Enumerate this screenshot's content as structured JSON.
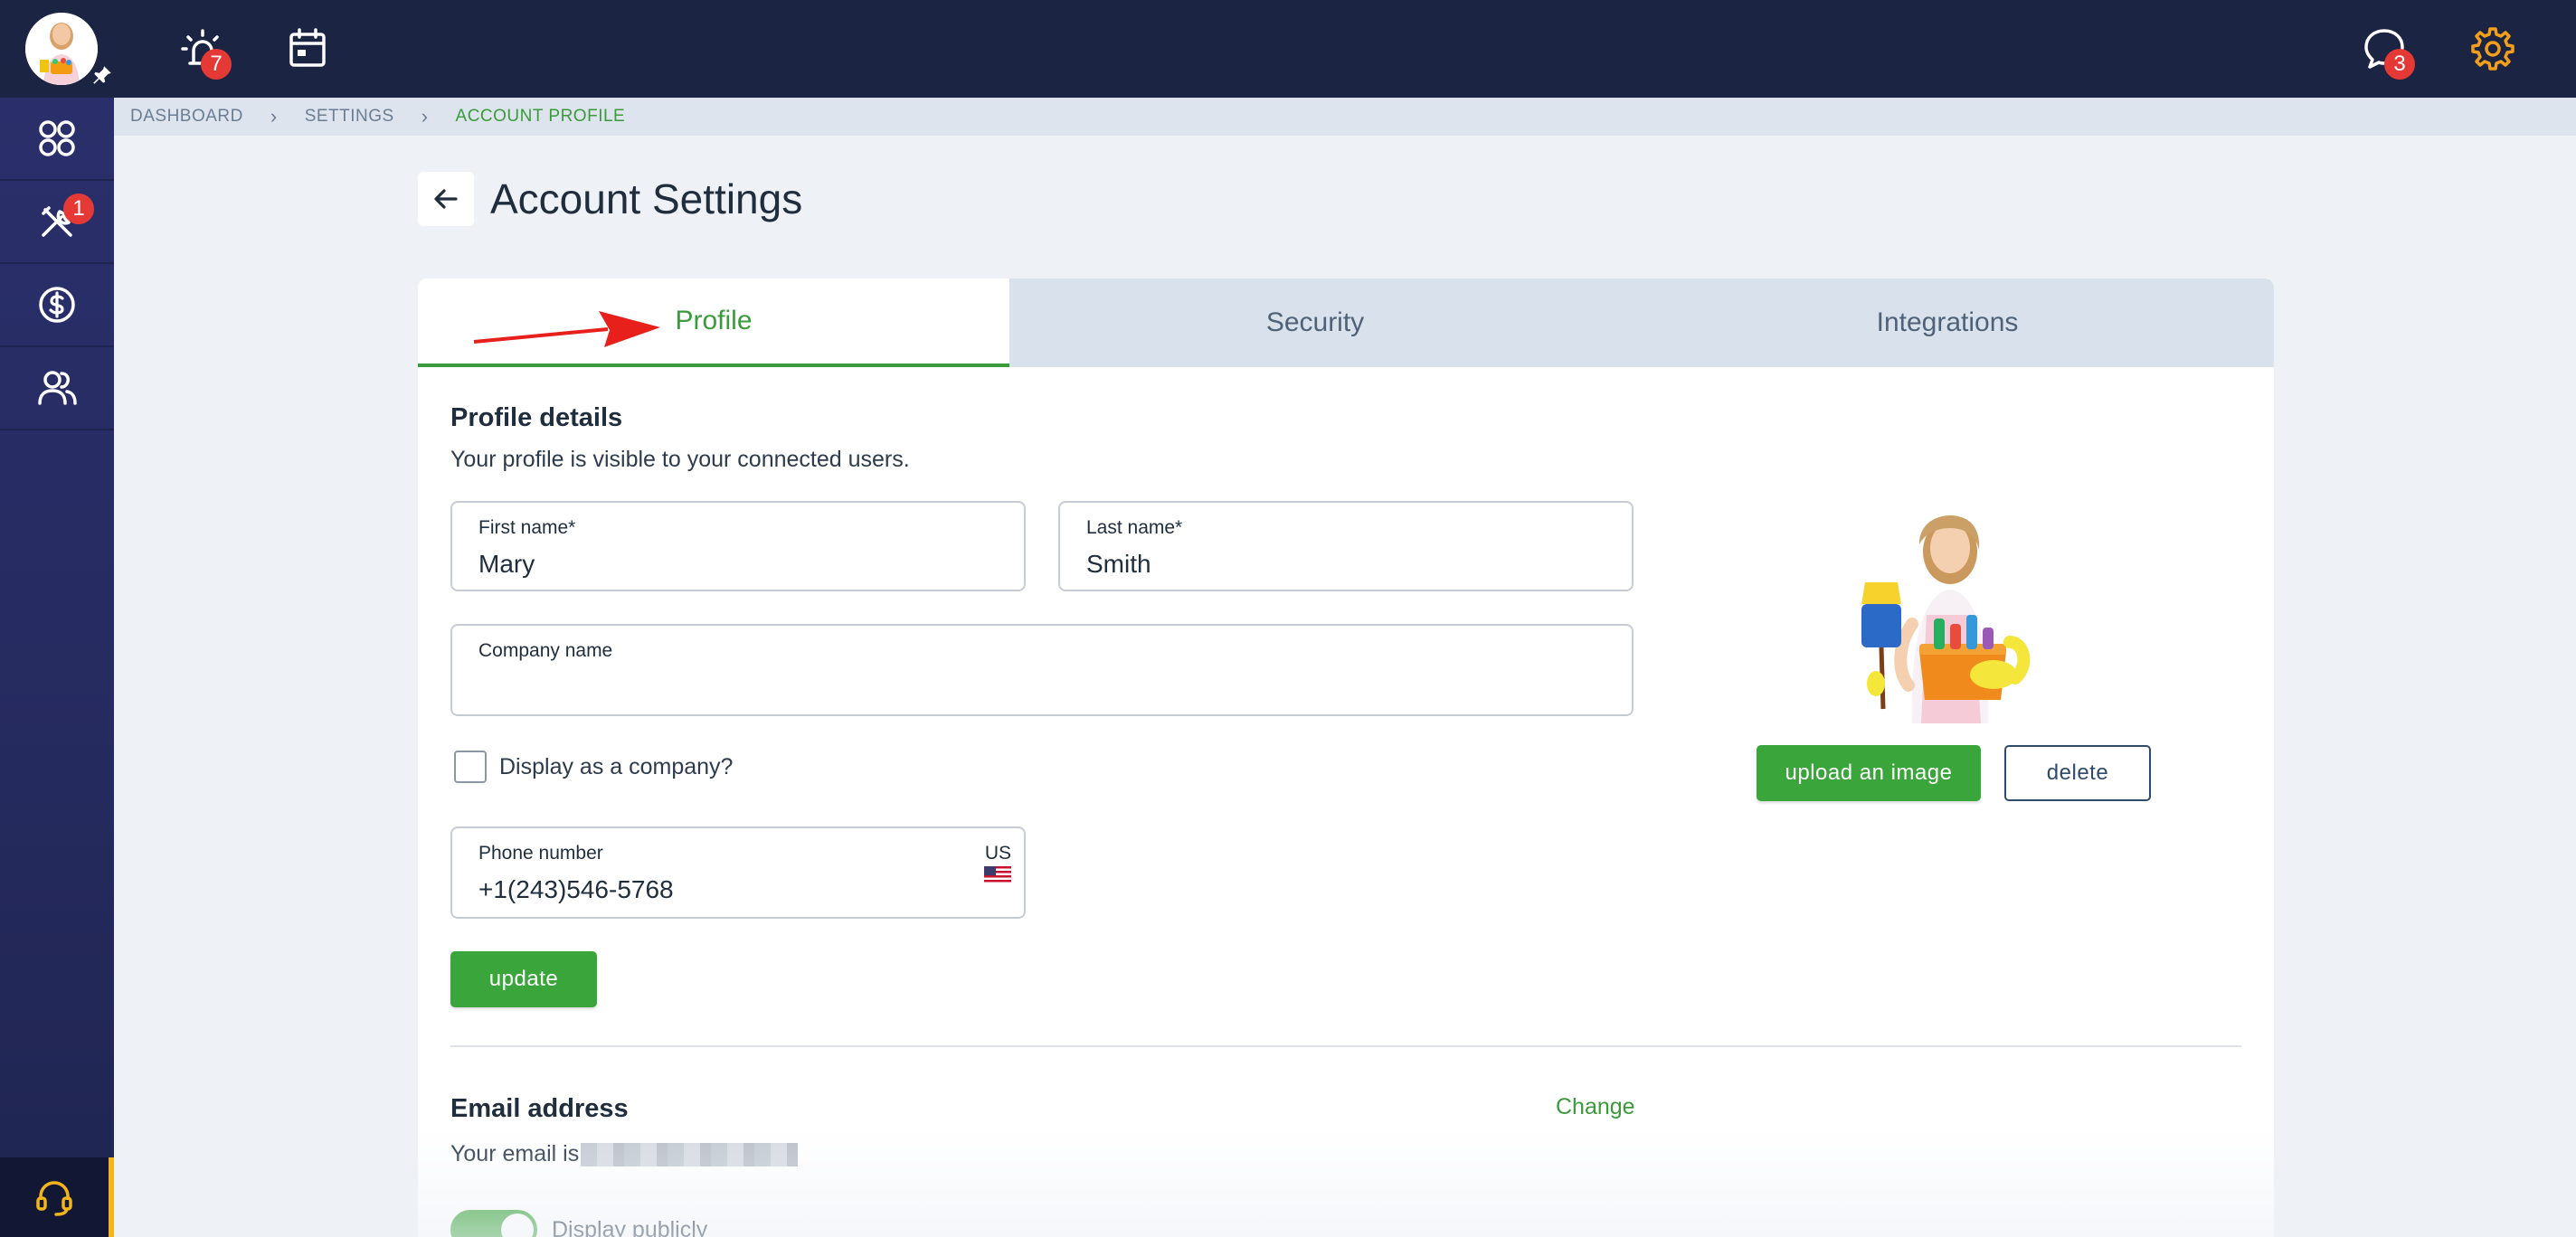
{
  "topbar": {
    "notifications_count": "7",
    "messages_count": "3"
  },
  "sidebar": {
    "items": [
      {
        "icon": "dashboard-grid-icon"
      },
      {
        "icon": "tools-icon",
        "badge": "1"
      },
      {
        "icon": "dollar-icon"
      },
      {
        "icon": "users-icon"
      }
    ],
    "support_icon": "headset-icon"
  },
  "breadcrumb": {
    "items": [
      "DASHBOARD",
      "SETTINGS",
      "ACCOUNT PROFILE"
    ]
  },
  "page": {
    "title": "Account Settings"
  },
  "tabs": [
    {
      "label": "Profile",
      "active": true
    },
    {
      "label": "Security",
      "active": false
    },
    {
      "label": "Integrations",
      "active": false
    }
  ],
  "profile": {
    "title": "Profile details",
    "subtitle": "Your profile is visible to your connected users.",
    "first_name_label": "First name*",
    "first_name_value": "Mary",
    "last_name_label": "Last name*",
    "last_name_value": "Smith",
    "company_label": "Company name",
    "company_value": "",
    "display_company_label": "Display as a company?",
    "phone_label": "Phone number",
    "phone_value": "+1(243)546-5768",
    "phone_country": "US",
    "update_label": "update",
    "upload_label": "upload an image",
    "delete_label": "delete"
  },
  "email": {
    "title": "Email address",
    "prefix": "Your email is",
    "change_label": "Change",
    "display_publicly_label": "Display publicly"
  },
  "colors": {
    "topbar": "#1c2443",
    "accent_green": "#3aa53a",
    "badge_red": "#e53935",
    "settings_gear": "#f2a01c"
  }
}
